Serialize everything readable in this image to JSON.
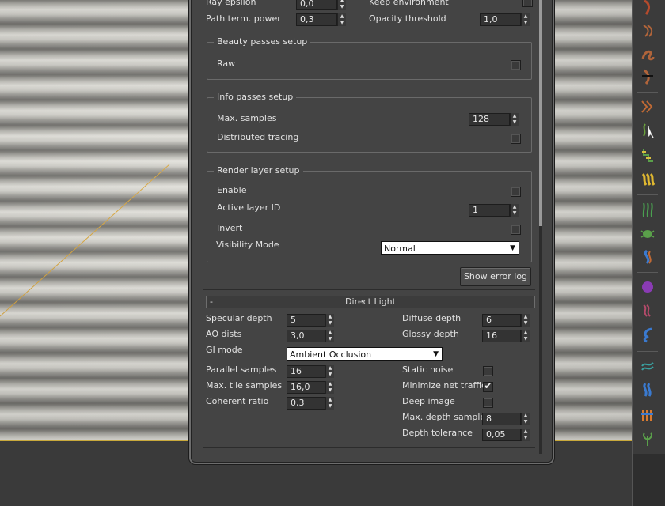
{
  "colors": {
    "panel_bg": "#444444",
    "viewport_frame": "#c8a93c",
    "guide_line": "#d9a437"
  },
  "top_section": {
    "ray_epsilon": {
      "label": "Ray epsilon",
      "value": "0,0"
    },
    "path_term_power": {
      "label": "Path term. power",
      "value": "0,3"
    },
    "keep_environment": {
      "label": "Keep environment",
      "checked": false
    },
    "opacity_threshold": {
      "label": "Opacity threshold",
      "value": "1,0"
    }
  },
  "beauty_passes": {
    "title": "Beauty passes setup",
    "raw": {
      "label": "Raw",
      "checked": false
    }
  },
  "info_passes": {
    "title": "Info passes setup",
    "max_samples": {
      "label": "Max. samples",
      "value": "128"
    },
    "distributed_tracing": {
      "label": "Distributed tracing",
      "checked": false
    }
  },
  "render_layer": {
    "title": "Render layer setup",
    "enable": {
      "label": "Enable",
      "checked": false
    },
    "active_layer_id": {
      "label": "Active layer ID",
      "value": "1"
    },
    "invert": {
      "label": "Invert",
      "checked": false
    },
    "visibility_mode": {
      "label": "Visibility Mode",
      "selected": "Normal"
    }
  },
  "show_error_log": {
    "label": "Show error log"
  },
  "direct_light": {
    "collapse_symbol": "-",
    "title": "Direct Light",
    "specular_depth": {
      "label": "Specular depth",
      "value": "5"
    },
    "ao_dists": {
      "label": "AO dists",
      "value": "3,0"
    },
    "gi_mode": {
      "label": "GI mode",
      "selected": "Ambient Occlusion"
    },
    "parallel_samples": {
      "label": "Parallel samples",
      "value": "16"
    },
    "max_tile_samples": {
      "label": "Max. tile samples",
      "value": "16,0"
    },
    "coherent_ratio": {
      "label": "Coherent ratio",
      "value": "0,3"
    },
    "diffuse_depth": {
      "label": "Diffuse depth",
      "value": "6"
    },
    "glossy_depth": {
      "label": "Glossy depth",
      "value": "16"
    },
    "static_noise": {
      "label": "Static noise",
      "checked": false
    },
    "minimize_net_traffic": {
      "label": "Minimize net traffic",
      "checked": true
    },
    "deep_image": {
      "label": "Deep image",
      "checked": false
    },
    "max_depth_samples": {
      "label": "Max. depth samples",
      "value": "8"
    },
    "depth_tolerance": {
      "label": "Depth tolerance",
      "value": "0,05"
    }
  },
  "toolbar_icons": [
    "hair-brush-icon",
    "hair-comb-icon",
    "hair-curl-icon",
    "hair-cut-icon",
    "hair-frizz-icon",
    "hair-select-icon",
    "hair-kink-icon",
    "hair-clump-icon",
    "hair-grass-icon",
    "hair-bug-icon",
    "hair-twist-icon",
    "hair-purple-icon",
    "hair-wave-icon",
    "hair-blue-icon",
    "hair-green-icon",
    "hair-blue-clump-icon",
    "hair-orange-icon",
    "hair-plant-icon"
  ]
}
